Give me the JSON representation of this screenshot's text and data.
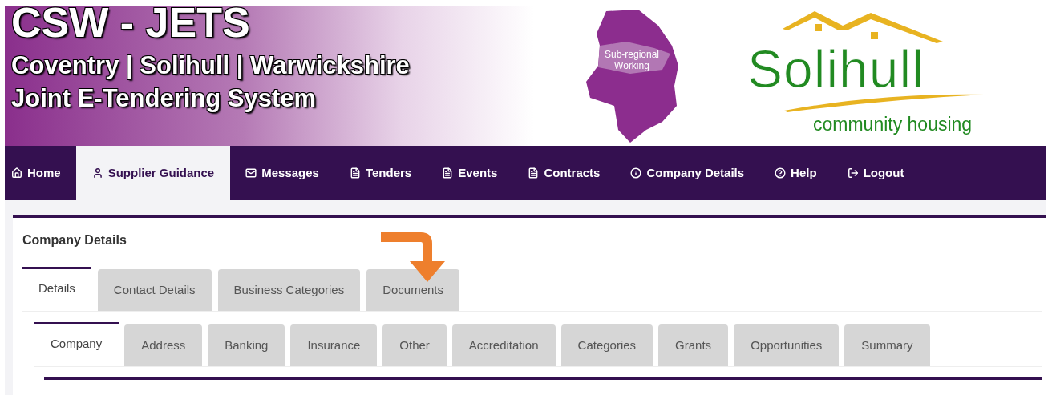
{
  "banner": {
    "title": "CSW - JETS",
    "subtitle": "Coventry | Solihull | Warwickshire",
    "tagline": "Joint E-Tendering System",
    "map_logo": "Sub-regional Working",
    "partner_logo": {
      "name": "Solihull",
      "tagline": "community housing"
    }
  },
  "nav": [
    {
      "label": "Home",
      "selected": false
    },
    {
      "label": "Supplier Guidance",
      "selected": true
    },
    {
      "label": "Messages",
      "selected": false
    },
    {
      "label": "Tenders",
      "selected": false
    },
    {
      "label": "Events",
      "selected": false
    },
    {
      "label": "Contracts",
      "selected": false
    },
    {
      "label": "Company Details",
      "selected": false
    },
    {
      "label": "Help",
      "selected": false
    },
    {
      "label": "Logout",
      "selected": false
    }
  ],
  "panel": {
    "title": "Company Details",
    "tabs": [
      {
        "label": "Details",
        "selected": true
      },
      {
        "label": "Contact Details",
        "selected": false
      },
      {
        "label": "Business Categories",
        "selected": false
      },
      {
        "label": "Documents",
        "selected": false
      }
    ],
    "subtabs": [
      {
        "label": "Company",
        "selected": true
      },
      {
        "label": "Address",
        "selected": false
      },
      {
        "label": "Banking",
        "selected": false
      },
      {
        "label": "Insurance",
        "selected": false
      },
      {
        "label": "Other",
        "selected": false
      },
      {
        "label": "Accreditation",
        "selected": false
      },
      {
        "label": "Categories",
        "selected": false
      },
      {
        "label": "Grants",
        "selected": false
      },
      {
        "label": "Opportunities",
        "selected": false
      },
      {
        "label": "Summary",
        "selected": false
      }
    ]
  }
}
